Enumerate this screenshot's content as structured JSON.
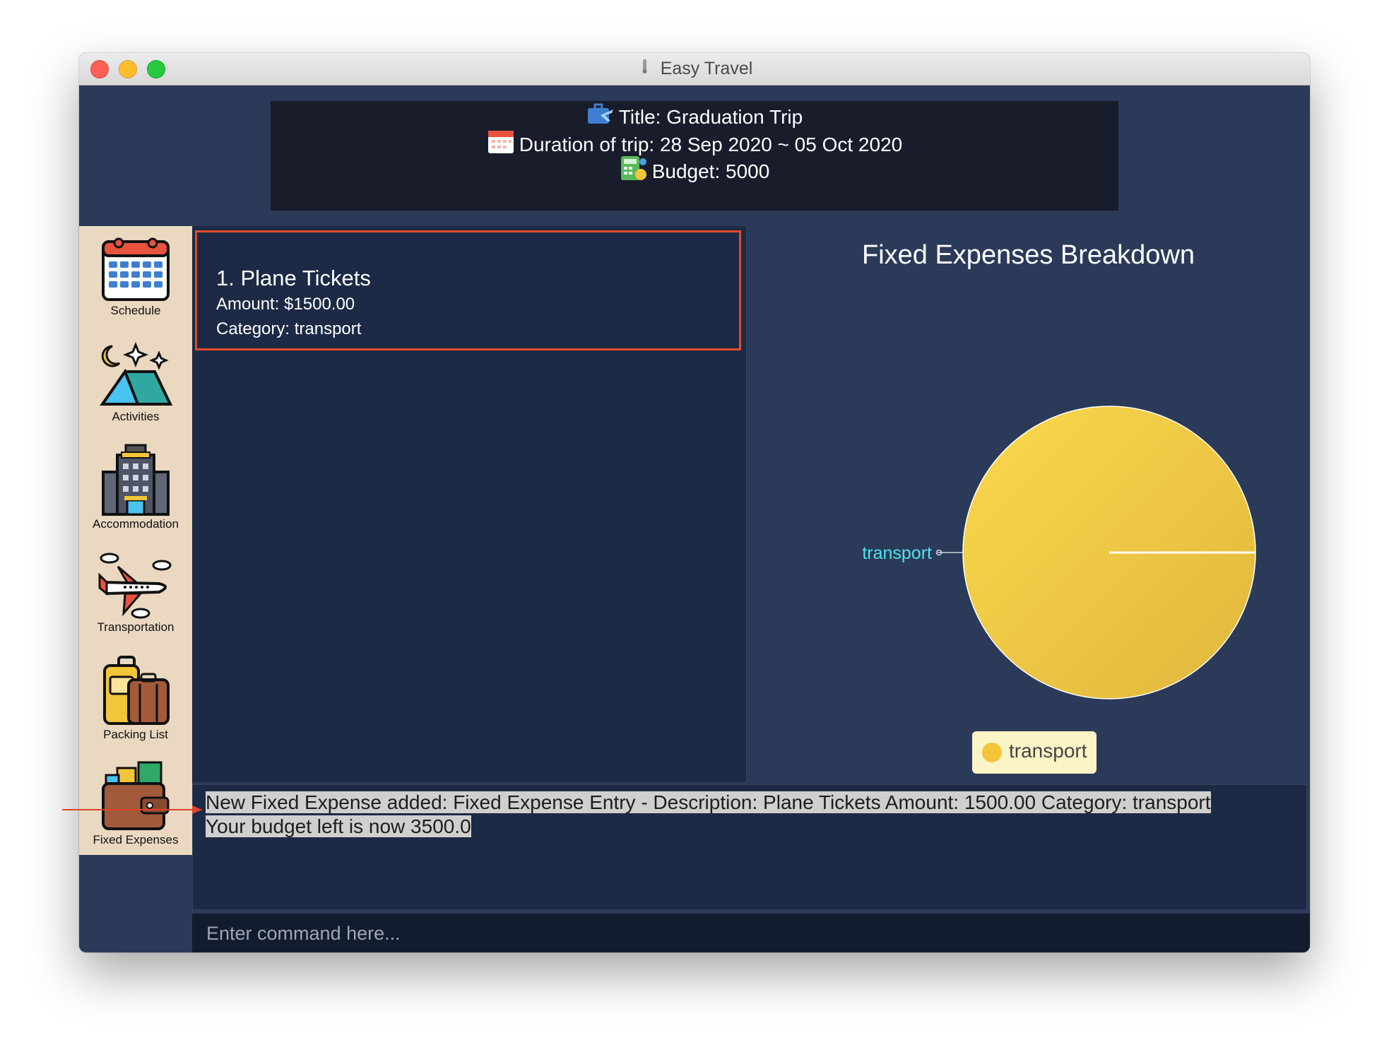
{
  "window": {
    "title": "Easy Travel"
  },
  "header": {
    "title": "Title: Graduation Trip",
    "duration": "Duration of trip: 28 Sep 2020 ~ 05 Oct 2020",
    "budget": "Budget: 5000"
  },
  "sidebar": {
    "items": [
      {
        "label": "Schedule",
        "icon": "calendar-icon"
      },
      {
        "label": "Activities",
        "icon": "tent-icon"
      },
      {
        "label": "Accommodation",
        "icon": "hotel-icon"
      },
      {
        "label": "Transportation",
        "icon": "airplane-icon"
      },
      {
        "label": "Packing List",
        "icon": "luggage-icon"
      },
      {
        "label": "Fixed Expenses",
        "icon": "wallet-icon"
      }
    ]
  },
  "expenses": [
    {
      "title": "1.  Plane Tickets",
      "amount": "Amount: $1500.00",
      "category": "Category: transport"
    }
  ],
  "chart_data": {
    "type": "pie",
    "title": "Fixed Expenses Breakdown",
    "categories": [
      "transport"
    ],
    "values": [
      1500.0
    ],
    "colors": [
      "#f2c53a"
    ],
    "legend_placement": "bottom"
  },
  "result": {
    "line1": "New Fixed Expense added: Fixed Expense Entry - Description: Plane Tickets Amount: 1500.00 Category: transport",
    "line2": "Your budget left is now 3500.0"
  },
  "command": {
    "placeholder": "Enter command here..."
  }
}
